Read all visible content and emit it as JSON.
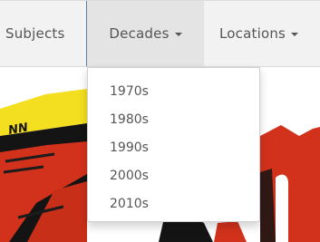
{
  "nav": {
    "items": [
      {
        "label": "Subjects",
        "has_caret": false
      },
      {
        "label": "Decades",
        "has_caret": true,
        "active": true
      },
      {
        "label": "Locations",
        "has_caret": true
      }
    ]
  },
  "decades_menu": {
    "items": [
      {
        "label": "1970s"
      },
      {
        "label": "1980s"
      },
      {
        "label": "1990s"
      },
      {
        "label": "2000s"
      },
      {
        "label": "2010s"
      }
    ]
  },
  "artwork": {
    "scribble_text": "NN",
    "colors": {
      "yellow": "#f3df1f",
      "red": "#d2321c",
      "black": "#141414"
    }
  },
  "colors": {
    "nav_background": "#f2f2f2",
    "nav_active_background": "#e4e4e4",
    "nav_text": "#555555",
    "active_border": "#5a7fa8",
    "menu_background": "#ffffff"
  }
}
